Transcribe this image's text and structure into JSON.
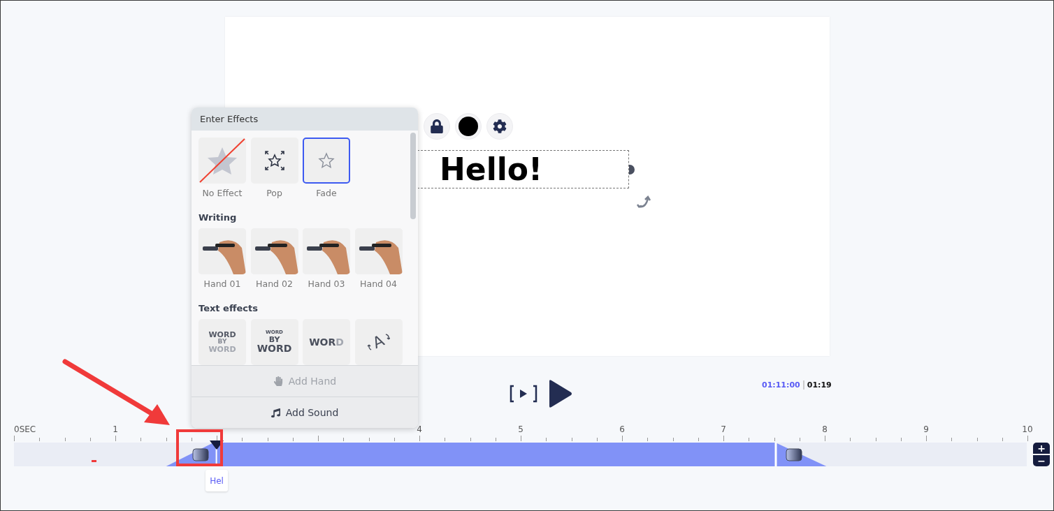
{
  "canvas": {
    "text": "Hello!"
  },
  "effects_panel": {
    "title": "Enter Effects",
    "basic": [
      {
        "label": "No Effect",
        "kind": "none",
        "selected": false
      },
      {
        "label": "Pop",
        "kind": "pop",
        "selected": false
      },
      {
        "label": "Fade",
        "kind": "fade",
        "selected": true
      }
    ],
    "sections": [
      {
        "title": "Writing",
        "items": [
          {
            "label": "Hand 01",
            "kind": "hand",
            "selected": false
          },
          {
            "label": "Hand 02",
            "kind": "hand",
            "selected": false
          },
          {
            "label": "Hand 03",
            "kind": "hand",
            "selected": false
          },
          {
            "label": "Hand 04",
            "kind": "hand",
            "selected": false
          }
        ]
      },
      {
        "title": "Text effects",
        "items": [
          {
            "kind": "word-by-word",
            "parts": [
              "WORD",
              "BY",
              "WORD"
            ],
            "selected": false
          },
          {
            "kind": "word-stack",
            "parts": [
              "WORD",
              "BY",
              "WORD"
            ],
            "selected": false
          },
          {
            "kind": "letter-fade",
            "parts": [
              "WOR",
              "D"
            ],
            "selected": false
          },
          {
            "kind": "rotate",
            "parts": [
              "A"
            ],
            "selected": false
          }
        ]
      }
    ],
    "buttons": [
      {
        "label": "Add Hand",
        "disabled": true
      },
      {
        "label": "Add Sound",
        "disabled": false
      }
    ]
  },
  "player": {
    "current_time": "01:11:00",
    "duration": "01:19"
  },
  "timeline": {
    "ticks_start": [
      "0SEC",
      "1"
    ],
    "ticks_end": [
      "4",
      "5",
      "6",
      "7",
      "8",
      "9",
      "10"
    ],
    "clip_label": "Hel",
    "zoom_buttons": [
      "+",
      "−"
    ]
  }
}
